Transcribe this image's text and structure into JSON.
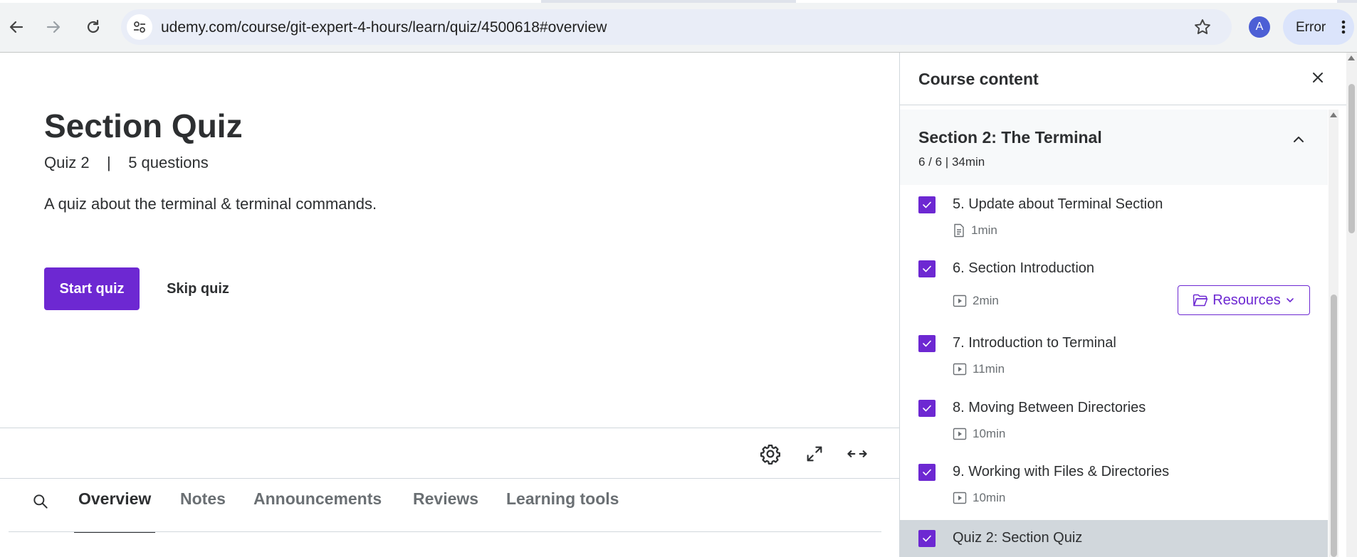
{
  "browser": {
    "url": "udemy.com/course/git-expert-4-hours/learn/quiz/4500618#overview",
    "profile_initial": "A",
    "error_label": "Error"
  },
  "quiz": {
    "title": "Section Quiz",
    "meta": "Quiz 2    |    5 questions",
    "description": "A quiz about the terminal & terminal commands.",
    "start_label": "Start quiz",
    "skip_label": "Skip quiz"
  },
  "tabs": [
    {
      "label": "Overview",
      "active": true
    },
    {
      "label": "Notes",
      "active": false
    },
    {
      "label": "Announcements",
      "active": false
    },
    {
      "label": "Reviews",
      "active": false
    },
    {
      "label": "Learning tools",
      "active": false
    }
  ],
  "sidebar": {
    "title": "Course content",
    "section": {
      "title": "Section 2: The Terminal",
      "meta": "6 / 6 | 34min"
    },
    "items": [
      {
        "title": "5. Update about Terminal Section",
        "duration": "1min",
        "icon": "document-icon",
        "checked": true
      },
      {
        "title": "6. Section Introduction",
        "duration": "2min",
        "icon": "video-icon",
        "checked": true,
        "resources_label": "Resources"
      },
      {
        "title": "7. Introduction to Terminal",
        "duration": "11min",
        "icon": "video-icon",
        "checked": true
      },
      {
        "title": "8. Moving Between Directories",
        "duration": "10min",
        "icon": "video-icon",
        "checked": true
      },
      {
        "title": "9. Working with Files & Directories",
        "duration": "10min",
        "icon": "video-icon",
        "checked": true
      },
      {
        "title": "Quiz 2: Section Quiz",
        "duration": "",
        "icon": "",
        "checked": true,
        "active": true
      }
    ]
  },
  "colors": {
    "accent": "#6d28d2",
    "text": "#2d2f31",
    "muted": "#6a6f73",
    "active_row": "#d1d7dc"
  }
}
